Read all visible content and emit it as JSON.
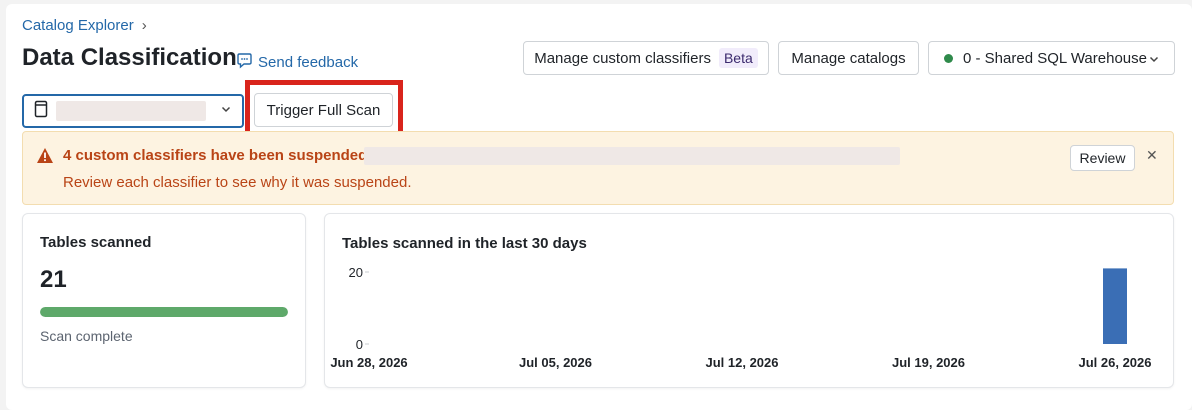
{
  "breadcrumb": {
    "root": "Catalog Explorer",
    "separator": "›"
  },
  "header": {
    "title": "Data Classification",
    "feedback_label": "Send feedback",
    "manage_custom_label": "Manage custom classifiers",
    "beta_badge": "Beta",
    "manage_catalogs_label": "Manage catalogs",
    "warehouse_label": "0 - Shared SQL Warehouse",
    "warehouse_status_color": "#2f8a4b"
  },
  "toolbar": {
    "trigger_scan_label": "Trigger Full Scan"
  },
  "alert": {
    "title": "4 custom classifiers have been suspended:",
    "body": "Review each classifier to see why it was suspended.",
    "review_label": "Review",
    "close_glyph": "✕",
    "warning_color": "#b94416"
  },
  "summary": {
    "title": "Tables scanned",
    "count": "21",
    "progress_percent": 100,
    "status": "Scan complete"
  },
  "chart_data": {
    "type": "bar",
    "title": "Tables scanned in the last 30 days",
    "x_tick_labels": [
      "Jun 28, 2026",
      "Jul 05, 2026",
      "Jul 12, 2026",
      "Jul 19, 2026",
      "Jul 26, 2026"
    ],
    "y_tick_labels": [
      "20",
      "0"
    ],
    "ylim": [
      0,
      20
    ],
    "xlim": [
      "Jun 28, 2026",
      "Jul 26, 2026"
    ],
    "series": [
      {
        "x": [
          "Jul 26, 2026"
        ],
        "values": [
          21
        ]
      }
    ],
    "bar_color": "#3a6eb5"
  }
}
